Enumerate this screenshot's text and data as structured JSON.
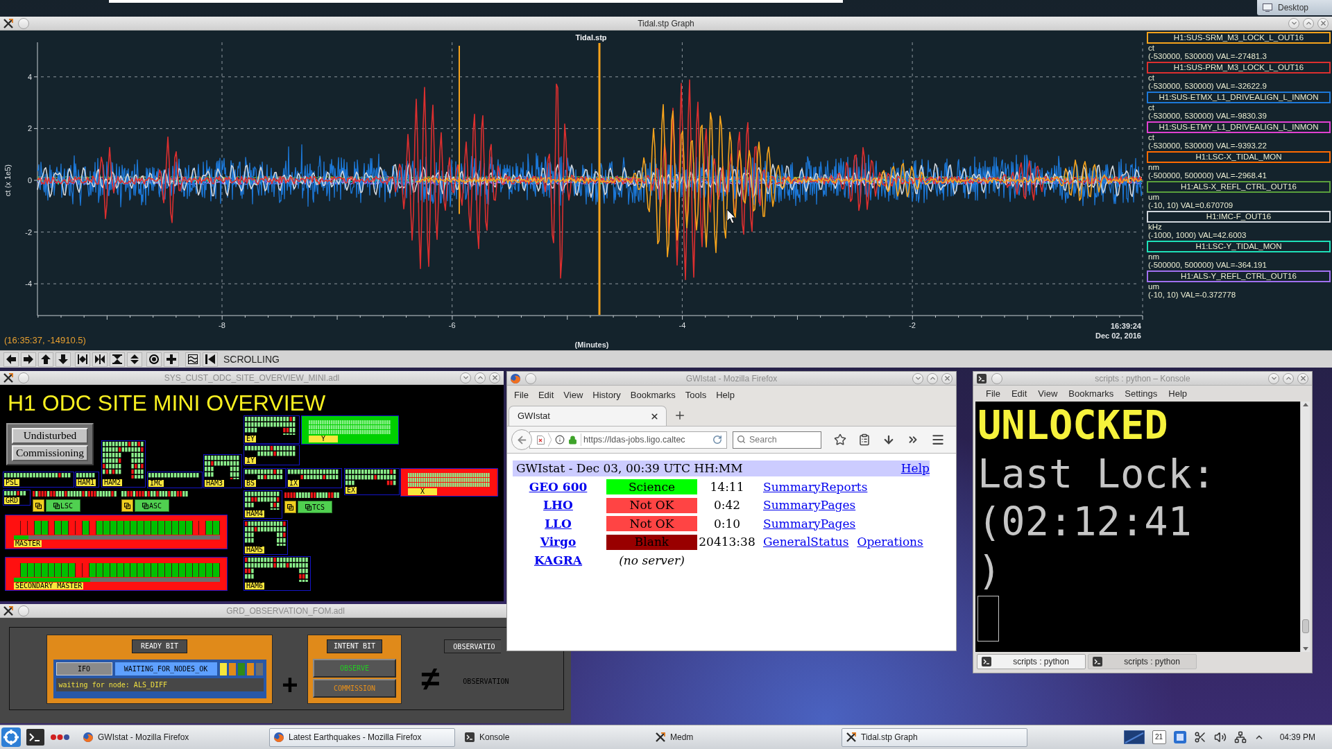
{
  "desktop": {
    "show_desktop_button": "Desktop"
  },
  "graph_window": {
    "title": "Tidal.stp Graph",
    "active": true,
    "plot_title": "Tidal.stp",
    "ylabel": "ct (x 1e5)",
    "yticks": [
      "4",
      "2",
      "0",
      "-2",
      "-4"
    ],
    "xticks": [
      "-8",
      "-6",
      "-4",
      "-2"
    ],
    "end_time": "16:39:24",
    "end_date": "Dec 02, 2016",
    "xlabel": "(Minutes)",
    "cursor_readout": "(16:35:37, -14910.5)",
    "mode": "SCROLLING",
    "channels": [
      {
        "name": "H1:SUS-SRM_M3_LOCK_L_OUT16",
        "unit": "ct",
        "range": "(-530000, 530000) VAL=-27481.3",
        "color": "#f5a31c"
      },
      {
        "name": "H1:SUS-PRM_M3_LOCK_L_OUT16",
        "unit": "ct",
        "range": "(-530000, 530000) VAL=-32622.9",
        "color": "#dc2f2f"
      },
      {
        "name": "H1:SUS-ETMX_L1_DRIVEALIGN_L_INMON",
        "unit": "ct",
        "range": "(-530000, 530000) VAL=-9830.39",
        "color": "#1c78d8"
      },
      {
        "name": "H1:SUS-ETMY_L1_DRIVEALIGN_L_INMON",
        "unit": "ct",
        "range": "(-530000, 530000) VAL=-9393.22",
        "color": "#e040d0"
      },
      {
        "name": "H1:LSC-X_TIDAL_MON",
        "unit": "nm",
        "range": "(-500000, 500000) VAL=-2968.41",
        "color": "#ff6a00"
      },
      {
        "name": "H1:ALS-X_REFL_CTRL_OUT16",
        "unit": "um",
        "range": "(-10, 10) VAL=0.670709",
        "color": "#5aa03c"
      },
      {
        "name": "H1:IMC-F_OUT16",
        "unit": "kHz",
        "range": "(-1000, 1000) VAL=42.6003",
        "color": "#d0d6dc"
      },
      {
        "name": "H1:LSC-Y_TIDAL_MON",
        "unit": "nm",
        "range": "(-500000, 500000) VAL=-364.191",
        "color": "#1ee0b8"
      },
      {
        "name": "H1:ALS-Y_REFL_CTRL_OUT16",
        "unit": "um",
        "range": "(-10, 10) VAL=-0.372778",
        "color": "#a070f0"
      }
    ]
  },
  "odc_window": {
    "title": "SYS_CUST_ODC_SITE_OVERVIEW_MINI.adl",
    "active": false,
    "heading": "H1 ODC SITE MINI OVERVIEW",
    "mode_buttons": [
      "Undisturbed",
      "Commissioning"
    ],
    "blocks": [
      {
        "kind": "grid",
        "label": "EY"
      },
      {
        "kind": "bar",
        "label": "Y",
        "alarm": false
      },
      {
        "kind": "grid",
        "label": "IY"
      },
      {
        "kind": "grid",
        "label": "PSL"
      },
      {
        "kind": "grid",
        "label": "HAM1"
      },
      {
        "kind": "grid",
        "label": "HAM2"
      },
      {
        "kind": "grid",
        "label": "IMC"
      },
      {
        "kind": "grid",
        "label": "HAM3"
      },
      {
        "kind": "grid",
        "label": "BS"
      },
      {
        "kind": "grid",
        "label": "IX"
      },
      {
        "kind": "grid",
        "label": "EX"
      },
      {
        "kind": "bar",
        "label": "X",
        "alarm": true
      },
      {
        "kind": "grid",
        "label": "GRD"
      },
      {
        "kind": "strip",
        "label": "LSC"
      },
      {
        "kind": "strip",
        "label": "ASC"
      },
      {
        "kind": "strip",
        "label": "TCS"
      },
      {
        "kind": "grid",
        "label": "HAM4"
      },
      {
        "kind": "master",
        "label": "MASTER",
        "alarm": true,
        "segments_ok": [
          false,
          false,
          false,
          true,
          true,
          false,
          true,
          true,
          false,
          false,
          true,
          false,
          true,
          true,
          true,
          true,
          true,
          true,
          true,
          true,
          true,
          true,
          true,
          true,
          true,
          true,
          false,
          false,
          true,
          true
        ],
        "level": 0.07
      },
      {
        "kind": "grid",
        "label": "HAM5"
      },
      {
        "kind": "master",
        "label": "SECONDARY MASTER",
        "alarm": true,
        "segments_ok": [
          false,
          true,
          true,
          true,
          true,
          true,
          true,
          true,
          true,
          false,
          false,
          true,
          true,
          true,
          true,
          true,
          true,
          true,
          true,
          true,
          true,
          true,
          true,
          true,
          true,
          true,
          true,
          true,
          true,
          true
        ],
        "level": 0.37
      },
      {
        "kind": "grid",
        "label": "HAM6"
      }
    ]
  },
  "grd_window": {
    "title": "GRD_OBSERVATION_FOM.adl",
    "active": false,
    "ready_bit": {
      "label": "READY BIT",
      "node": "IFO",
      "state": "WAITING_FOR_NODES_OK",
      "indicators": [
        {
          "color": "#f5e63c"
        },
        {
          "color": "#e08a1a"
        },
        {
          "color": "#2f8a1a"
        },
        {
          "color": "#e08a1a"
        },
        {
          "color": "#6e6e6e"
        }
      ],
      "message": "waiting for node: ALS_DIFF"
    },
    "plus": "+",
    "intent_bit": {
      "label": "INTENT BIT",
      "buttons": [
        {
          "kind": "observe",
          "label": "OBSERVE"
        },
        {
          "kind": "commission",
          "label": "COMMISSION"
        }
      ]
    },
    "operator": "≠",
    "observation_button": "OBSERVATIO",
    "observation_label": "OBSERVATION"
  },
  "browser_window": {
    "title": "GWIstat - Mozilla Firefox",
    "active": false,
    "menu": [
      "File",
      "Edit",
      "View",
      "History",
      "Bookmarks",
      "Tools",
      "Help"
    ],
    "tabs": [
      {
        "label": "GWIstat",
        "selected": true
      }
    ],
    "url": "https://ldas-jobs.ligo.caltec",
    "search": {
      "placeholder": "Search"
    },
    "page": {
      "heading": "GWIstat - Dec 03, 00:39 UTC HH:MM",
      "help": "Help",
      "rows": [
        {
          "kind": "status",
          "site": "GEO 600",
          "status": "Science",
          "color": "#00ff00",
          "time": "14:11",
          "links": [
            "SummaryReports"
          ]
        },
        {
          "kind": "status",
          "site": "LHO",
          "status": "Not OK",
          "color": "#ff4444",
          "time": "0:42",
          "links": [
            "SummaryPages"
          ]
        },
        {
          "kind": "status",
          "site": "LLO",
          "status": "Not OK",
          "color": "#ff4444",
          "time": "0:10",
          "links": [
            "SummaryPages"
          ]
        },
        {
          "kind": "status",
          "site": "Virgo",
          "status": "Blank",
          "color": "#990000",
          "time": "20413:38",
          "links": [
            "GeneralStatus",
            "Operations"
          ]
        },
        {
          "kind": "note",
          "site": "KAGRA",
          "note": "(no server)"
        }
      ]
    }
  },
  "terminal_window": {
    "title": "scripts : python – Konsole",
    "active": false,
    "menu": [
      "File",
      "Edit",
      "View",
      "Bookmarks",
      "Settings",
      "Help"
    ],
    "lines": [
      {
        "kind": "alert",
        "text": "UNLOCKED"
      },
      {
        "kind": "plain",
        "text": "Last Lock:"
      },
      {
        "kind": "plain",
        "text": "(02:12:41"
      },
      {
        "kind": "plain",
        "text": ")"
      }
    ],
    "tabs": [
      {
        "label": "scripts : python",
        "selected": true
      },
      {
        "label": "scripts : python",
        "selected": false
      }
    ]
  },
  "taskbar": {
    "tasks": [
      {
        "kind": "firefox",
        "label": "GWIstat - Mozilla Firefox",
        "selected": false
      },
      {
        "kind": "firefox",
        "label": "Latest Earthquakes - Mozilla Firefox",
        "selected": true
      },
      {
        "kind": "terminal",
        "label": "Konsole",
        "selected": false
      },
      {
        "kind": "medm",
        "label": "Medm",
        "selected": false
      },
      {
        "kind": "medm",
        "label": "Tidal.stp Graph",
        "selected": true
      }
    ],
    "calendar_day": "21",
    "clock": "04:39 PM"
  }
}
